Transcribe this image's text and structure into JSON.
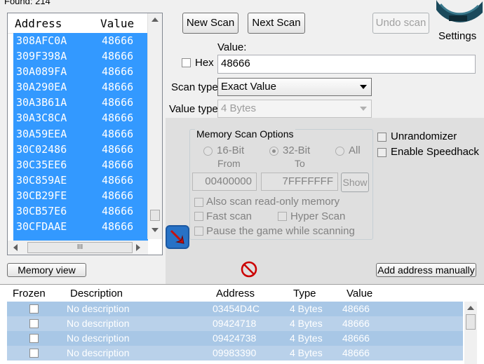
{
  "found_label": "Found: 214",
  "results": {
    "header_address": "Address",
    "header_value": "Value",
    "rows": [
      {
        "address": "308AFC0A",
        "value": "48666"
      },
      {
        "address": "309F398A",
        "value": "48666"
      },
      {
        "address": "30A089FA",
        "value": "48666"
      },
      {
        "address": "30A290EA",
        "value": "48666"
      },
      {
        "address": "30A3B61A",
        "value": "48666"
      },
      {
        "address": "30A3C8CA",
        "value": "48666"
      },
      {
        "address": "30A59EEA",
        "value": "48666"
      },
      {
        "address": "30C02486",
        "value": "48666"
      },
      {
        "address": "30C35EE6",
        "value": "48666"
      },
      {
        "address": "30C859AE",
        "value": "48666"
      },
      {
        "address": "30CB29FE",
        "value": "48666"
      },
      {
        "address": "30CB57E6",
        "value": "48666"
      },
      {
        "address": "30CFDAAE",
        "value": "48666"
      }
    ],
    "hscroll_grip": "III"
  },
  "buttons": {
    "new_scan": "New Scan",
    "next_scan": "Next Scan",
    "undo_scan": "Undo scan",
    "settings": "Settings",
    "memory_view": "Memory view",
    "add_address": "Add address manually",
    "show": "Show"
  },
  "value_section": {
    "value_label": "Value:",
    "hex_label": "Hex",
    "value_input": "48666",
    "scan_type_label": "Scan type",
    "scan_type_value": "Exact Value",
    "value_type_label": "Value type",
    "value_type_value": "4 Bytes"
  },
  "memory_options": {
    "title": "Memory Scan Options",
    "radio_16": "16-Bit",
    "radio_32": "32-Bit",
    "radio_all": "All",
    "from_label": "From",
    "to_label": "To",
    "from_value": "00400000",
    "to_value": "7FFFFFFF",
    "also_scan_readonly": "Also scan read-only memory",
    "fast_scan": "Fast scan",
    "hyper_scan": "Hyper Scan",
    "pause_game": "Pause the game while scanning"
  },
  "side_options": {
    "unrandomizer": "Unrandomizer",
    "speedhack": "Enable Speedhack"
  },
  "address_table": {
    "headers": {
      "frozen": "Frozen",
      "description": "Description",
      "address": "Address",
      "type": "Type",
      "value": "Value"
    },
    "rows": [
      {
        "description": "No description",
        "address": "03454D4C",
        "type": "4 Bytes",
        "value": "48666"
      },
      {
        "description": "No description",
        "address": "09424718",
        "type": "4 Bytes",
        "value": "48666"
      },
      {
        "description": "No description",
        "address": "09424738",
        "type": "4 Bytes",
        "value": "48666"
      },
      {
        "description": "No description",
        "address": "09983390",
        "type": "4 Bytes",
        "value": "48666"
      }
    ]
  },
  "colors": {
    "selection": "#3399ff",
    "table_row": "#b9d1ea",
    "accent_red": "#cc0000"
  },
  "icons": [
    "cheat-engine-logo",
    "arrow-add-icon",
    "stop-icon",
    "checkbox-icon",
    "radio-icon",
    "chevron-down-icon"
  ]
}
